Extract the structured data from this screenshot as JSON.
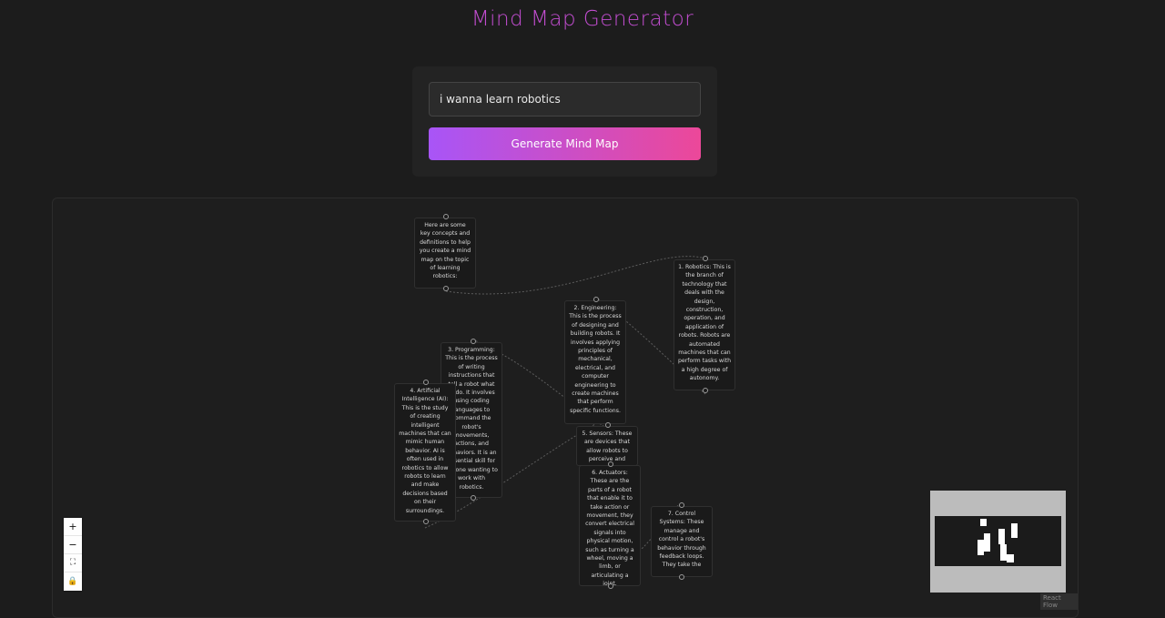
{
  "app": {
    "title": "Mind Map Generator"
  },
  "form": {
    "prompt_value": "i wanna learn robotics",
    "generate_label": "Generate Mind Map"
  },
  "mindmap": {
    "nodes": [
      {
        "id": "intro",
        "text": "Here are some key concepts and definitions to help you create a mind map on the topic of learning robotics:"
      },
      {
        "id": "robotics",
        "text": "1. Robotics: This is the branch of technology that deals with the design, construction, operation, and application of robots. Robots are automated machines that can perform tasks with a high degree of autonomy."
      },
      {
        "id": "engineering",
        "text": "2. Engineering: This is the process of designing and building robots. It involves applying principles of mechanical, electrical, and computer engineering to create machines that perform specific functions."
      },
      {
        "id": "programming",
        "text": "3. Programming: This is the process of writing instructions that tell a robot what to do. It involves using coding languages to command the robot's movements, actions, and behaviors. It is an essential skill for anyone wanting to work with robotics."
      },
      {
        "id": "ai",
        "text": "4. Artificial Intelligence (AI): This is the study of creating intelligent machines that can mimic human behavior. AI is often used in robotics to allow robots to learn and make decisions based on their surroundings."
      },
      {
        "id": "sensors",
        "text": "5. Sensors: These are devices that allow robots to perceive and"
      },
      {
        "id": "actuators",
        "text": "6. Actuators: These are the parts of a robot that enable it to take action or movement, they convert electrical signals into physical motion, such as turning a wheel, moving a limb, or articulating a joint."
      },
      {
        "id": "control",
        "text": "7. Control Systems: These manage and control a robot's behavior through feedback loops. They take the"
      }
    ]
  },
  "controls": {
    "zoom_in_icon": "+",
    "zoom_out_icon": "−",
    "fit_view_icon": "⛶",
    "lock_icon": "🔒"
  },
  "attribution": {
    "label": "React Flow"
  },
  "colors": {
    "title": "#c24dd0",
    "button_start": "#a855f7",
    "button_end": "#ec4899",
    "background": "#1c1c1c"
  }
}
